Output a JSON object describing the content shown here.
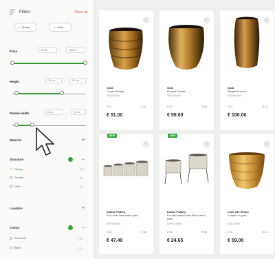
{
  "sidebar": {
    "title": "Filters",
    "clear_label": "Clear all",
    "chips": [
      "Brown",
      "Gold"
    ],
    "price": {
      "label": "Price",
      "min": "24.95",
      "max": "189.00"
    },
    "height": {
      "label": "Height",
      "min": "19 cm",
      "max": "53 cm"
    },
    "diameter": {
      "label": "Planter width",
      "min": "26 cm",
      "max": "36 cm"
    },
    "sections": {
      "material": "Material",
      "structure": "Structure",
      "location": "Location",
      "colour": "Colour"
    },
    "structure_options": [
      {
        "label": "Glossy",
        "count": "(29)"
      },
      {
        "label": "Smooth",
        "count": "(8)"
      },
      {
        "label": "Other",
        "count": "(2)"
      }
    ],
    "colour_options": [
      {
        "label": "Anthracite",
        "count": "(16)"
      },
      {
        "label": "Black",
        "count": "(12)"
      }
    ]
  },
  "products": [
    {
      "brand": "Gold",
      "name": "Couple Beauty!",
      "sku": "VASGP9001",
      "dims": "D 41",
      "dims2": "H 41",
      "price": "€ 51.00",
      "badge": "",
      "kind": "bowl"
    },
    {
      "brand": "Gold",
      "name": "Elegant Vrouwe",
      "sku": "VASGP9002",
      "dims": "D 41",
      "dims2": "H 39",
      "price": "€ 59.00",
      "badge": "",
      "kind": "round"
    },
    {
      "brand": "Gold",
      "name": "Elegant Vrouwe",
      "sku": "VASGP9009",
      "dims": "D 41",
      "dims2": "H 74",
      "price": "€ 100.00",
      "badge": "",
      "kind": "tall"
    },
    {
      "brand": "Indoor Pottery",
      "name": "Pot Lunar Steel hale a pilot",
      "sku": "INTPOT4001",
      "dims": "D 24",
      "dims2": "H 18",
      "price": "€ 47.49",
      "badge": "NEW",
      "kind": "set"
    },
    {
      "brand": "Indoor Pottery",
      "name": "Pot with stand Lunar Steel hale a plant",
      "sku": "INTPOT4003",
      "dims": "D 33",
      "dims2": "H 34",
      "price": "€ 24.65",
      "badge": "NEW",
      "kind": "stand"
    },
    {
      "brand": "Love Life Roses",
      "name": "Couple Lux gold",
      "sku": "ELELXGP4",
      "dims": "D 33",
      "dims2": "H 24",
      "price": "€ 59.00",
      "badge": "",
      "kind": "wide"
    }
  ],
  "colors": {
    "accent_green": "#3aa53a",
    "clear_red": "#e05a4a"
  }
}
